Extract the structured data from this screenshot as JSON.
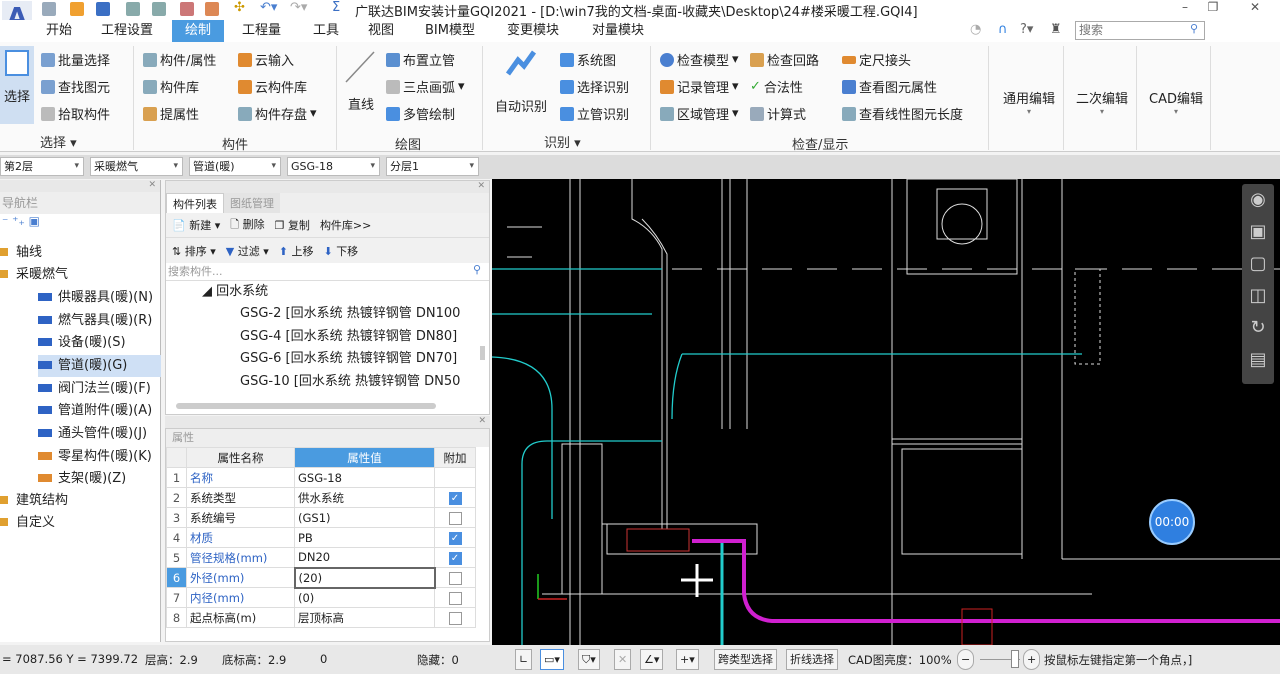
{
  "app": {
    "logo": "A",
    "title": "广联达BIM安装计量GQI2021 - [D:\\win7我的文档-桌面-收藏夹\\Desktop\\24#楼采暖工程.GQI4]",
    "search_placeholder": "搜索"
  },
  "menu": [
    "开始",
    "工程设置",
    "绘制",
    "工程量",
    "工具",
    "视图",
    "BIM模型",
    "变更模块",
    "对量模块"
  ],
  "ribbon": {
    "select": {
      "big": "选择",
      "items": [
        "批量选择",
        "查找图元",
        "拾取构件"
      ],
      "group": "选择"
    },
    "component": {
      "items": [
        "构件/属性",
        "构件库",
        "提属性",
        "云输入",
        "云构件库",
        "构件存盘"
      ],
      "group": "构件"
    },
    "draw": {
      "big": "直线",
      "items": [
        "布置立管",
        "三点画弧",
        "多管绘制"
      ],
      "group": "绘图"
    },
    "identify": {
      "big": "自动识别",
      "items": [
        "系统图",
        "选择识别",
        "立管识别"
      ],
      "group": "识别"
    },
    "check": {
      "items": [
        "检查模型",
        "记录管理",
        "区域管理",
        "检查回路",
        "合法性",
        "计算式",
        "定尺接头",
        "查看图元属性",
        "查看线性图元长度"
      ],
      "group": "检查/显示"
    },
    "edit": [
      "通用编辑",
      "二次编辑",
      "CAD编辑"
    ]
  },
  "filters": [
    "第2层",
    "采暖燃气",
    "管道(暖)",
    "GSG-18",
    "分层1"
  ],
  "nav": {
    "title": "导航栏",
    "items": [
      "轴线",
      "采暖燃气",
      "供暖器具(暖)(N)",
      "燃气器具(暖)(R)",
      "设备(暖)(S)",
      "管道(暖)(G)",
      "阀门法兰(暖)(F)",
      "管道附件(暖)(A)",
      "通头管件(暖)(J)",
      "零星构件(暖)(K)",
      "支架(暖)(Z)",
      "建筑结构",
      "自定义"
    ]
  },
  "components": {
    "tabs": [
      "构件列表",
      "图纸管理"
    ],
    "toolbar1": [
      "新建",
      "删除",
      "复制",
      "构件库>>"
    ],
    "toolbar2": [
      "排序",
      "过滤",
      "上移",
      "下移"
    ],
    "search_placeholder": "搜索构件...",
    "group": "回水系统",
    "items": [
      "GSG-2 [回水系统 热镀锌钢管 DN100",
      "GSG-4 [回水系统 热镀锌钢管 DN80]",
      "GSG-6 [回水系统 热镀锌钢管 DN70]",
      "GSG-10 [回水系统 热镀锌钢管 DN50"
    ]
  },
  "properties": {
    "title": "属性",
    "headers": [
      "属性名称",
      "属性值",
      "附加"
    ],
    "rows": [
      {
        "n": "1",
        "name": "名称",
        "value": "GSG-18",
        "blue": true,
        "chk": null
      },
      {
        "n": "2",
        "name": "系统类型",
        "value": "供水系统",
        "blue": false,
        "chk": true
      },
      {
        "n": "3",
        "name": "系统编号",
        "value": "(GS1)",
        "blue": false,
        "chk": false
      },
      {
        "n": "4",
        "name": "材质",
        "value": "PB",
        "blue": true,
        "chk": true
      },
      {
        "n": "5",
        "name": "管径规格(mm)",
        "value": "DN20",
        "blue": true,
        "chk": true
      },
      {
        "n": "6",
        "name": "外径(mm)",
        "value": "(20)",
        "blue": true,
        "chk": false
      },
      {
        "n": "7",
        "name": "内径(mm)",
        "value": "(0)",
        "blue": true,
        "chk": false
      },
      {
        "n": "8",
        "name": "起点标高(m)",
        "value": "层顶标高",
        "blue": false,
        "chk": false
      }
    ]
  },
  "cad": {
    "timer": "00:00"
  },
  "status": {
    "coords": "= 7087.56 Y = 7399.72",
    "floor_h": "层高：2.9",
    "base_h": "底标高：2.9",
    "zero": "0",
    "hidden": "隐藏：0",
    "cross_type": "跨类型选择",
    "polyline": "折线选择",
    "brightness": "CAD图亮度：100%",
    "hint": "按鼠标左键指定第一个角点，]"
  }
}
